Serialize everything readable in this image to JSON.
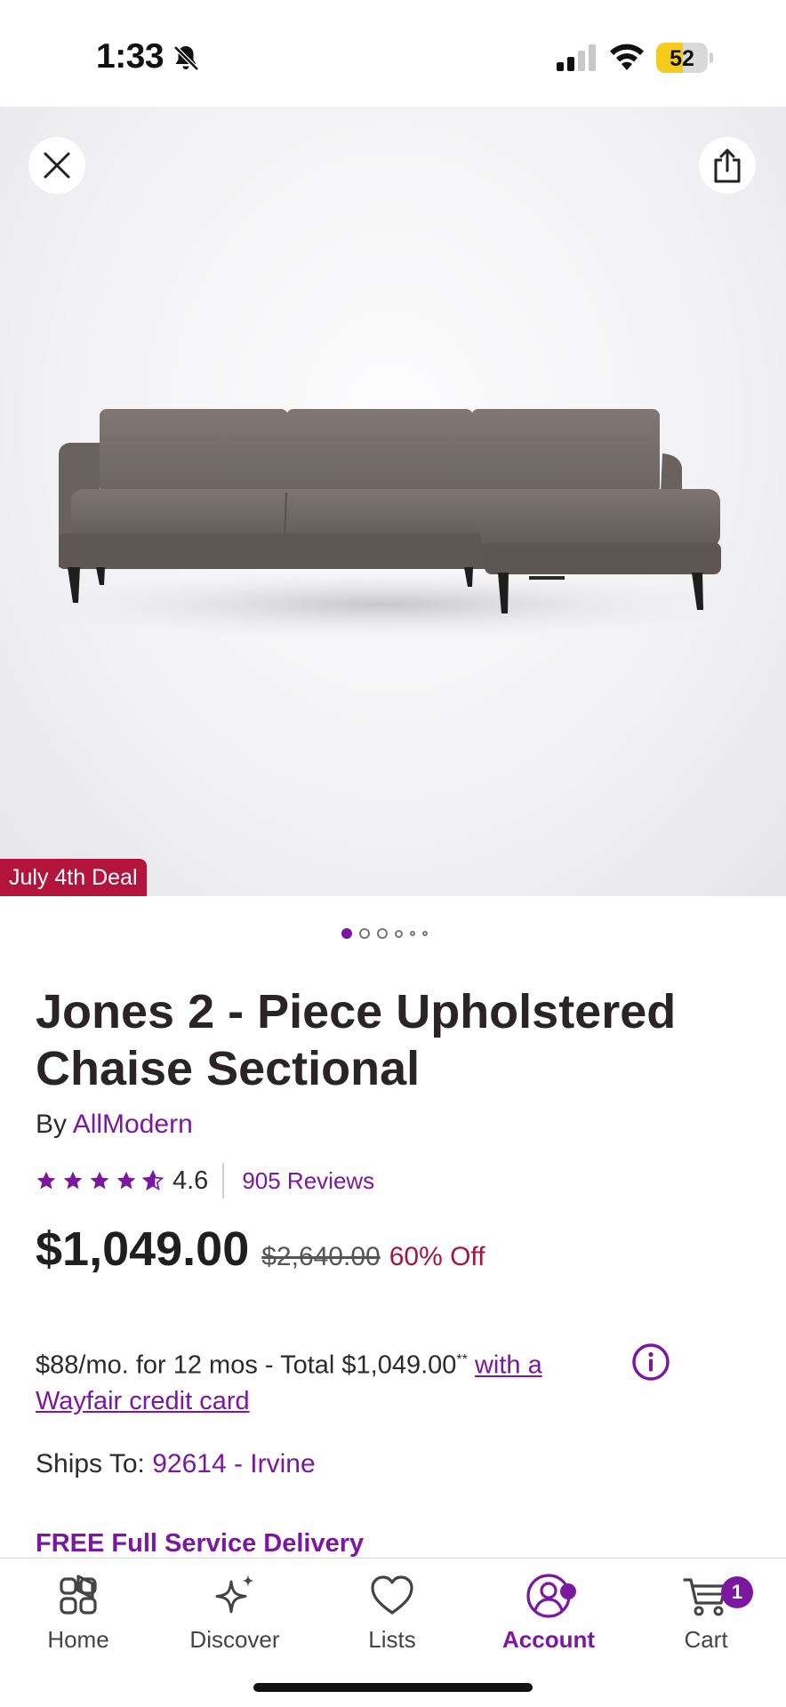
{
  "status_bar": {
    "time": "1:33",
    "battery_percent": "52",
    "battery_level": 0.52,
    "icons": [
      "bell-off-icon",
      "cellular-signal-icon",
      "wifi-icon",
      "battery-icon"
    ]
  },
  "hero": {
    "badge": "July 4th Deal",
    "image_description_icon": "sofa-image",
    "carousel": {
      "total": 6,
      "active_index": 0
    },
    "buttons": {
      "close_icon": "close-icon",
      "share_icon": "share-icon"
    }
  },
  "product": {
    "title": "Jones 2 - Piece Upholstered Chaise Sectional",
    "by_prefix": "By ",
    "brand": "AllModern",
    "rating": "4.6",
    "rating_value": 4.6,
    "reviews": "905 Reviews",
    "price": "$1,049.00",
    "original_price": "$2,640.00",
    "discount": "60% Off",
    "finance_text": "$88/mo. for 12 mos - Total $1,049.00",
    "finance_mark": "**",
    "finance_link": "with a Wayfair credit card",
    "ships_prefix": "Ships To: ",
    "ships_location": "92614 - Irvine",
    "delivery": "FREE Full Service Delivery"
  },
  "nav": {
    "items": [
      {
        "label": "Home",
        "icon": "home-icon"
      },
      {
        "label": "Discover",
        "icon": "sparkle-icon"
      },
      {
        "label": "Lists",
        "icon": "heart-icon"
      },
      {
        "label": "Account",
        "icon": "account-icon",
        "active": true
      },
      {
        "label": "Cart",
        "icon": "cart-icon",
        "badge": "1"
      }
    ]
  },
  "colors": {
    "accent": "#7b189f",
    "deal": "#b3143c",
    "discount": "#a3173f",
    "battery": "#f5cc1b"
  }
}
